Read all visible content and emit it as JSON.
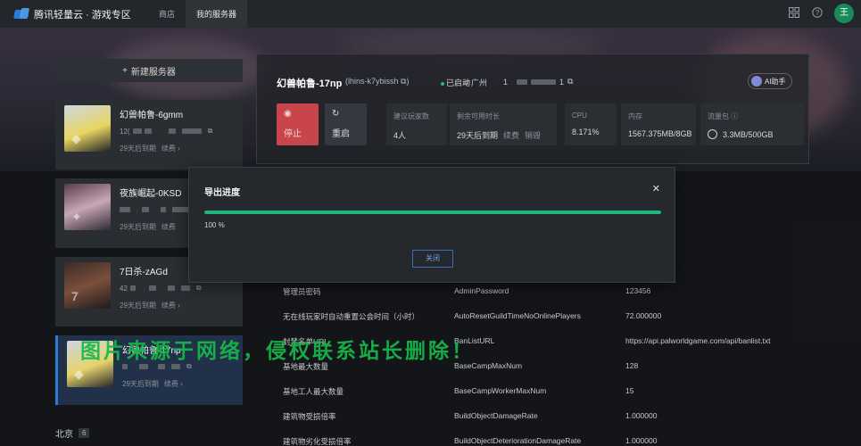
{
  "topbar": {
    "brand": "腾讯轻量云 · 游戏专区",
    "tabs": [
      {
        "label": "商店",
        "active": false
      },
      {
        "label": "我的服务器",
        "active": true
      }
    ],
    "avatar_label": "王",
    "icons": [
      "grid-icon",
      "help-icon"
    ]
  },
  "sidebar": {
    "new_server_label": "新建服务器",
    "servers": [
      {
        "name": "幻兽帕鲁-6gmm",
        "ip": "12(",
        "expiry": "29天后到期",
        "renew": "续费"
      },
      {
        "name": "夜族崛起-0KSD",
        "ip": "",
        "expiry": "29天后到期",
        "renew": "续费"
      },
      {
        "name": "7日杀-zAGd",
        "ip": "42",
        "expiry": "29天后到期",
        "renew": "续费"
      },
      {
        "name": "幻兽帕鲁-17np",
        "ip": "",
        "expiry": "29天后到期",
        "renew": "续费"
      }
    ],
    "region": {
      "label": "北京",
      "count": "6"
    }
  },
  "main": {
    "title": "幻兽帕鲁-17np",
    "instance_id": "(lhins-k7ybissh",
    "status": "已启动",
    "location": "广州",
    "ip_prefix": "1",
    "ip_suffix": "1",
    "ai_label": "AI助手",
    "stop_label": "停止",
    "restart_label": "重启",
    "stats": {
      "players_label": "建议玩家数",
      "players_value": "4人",
      "remaining_label": "剩余可用时长",
      "remaining_value": "29天后到期",
      "renew_label": "续费",
      "destroy_label": "销毁",
      "cpu_label": "CPU",
      "cpu_value": "8.171%",
      "mem_label": "内存",
      "mem_value": "1567.375MB/8GB",
      "traffic_label": "流量包",
      "traffic_value": "3.3MB/500GB"
    }
  },
  "config_rows": [
    {
      "name": "管理员密码",
      "key": "AdminPassword",
      "value": "123456"
    },
    {
      "name": "无在线玩家时自动重置公会时间（小时）",
      "key": "AutoResetGuildTimeNoOnlinePlayers",
      "value": "72.000000"
    },
    {
      "name": "封禁名单URL",
      "key": "BanListURL",
      "value": "https://api.palworldgame.com/api/banlist.txt"
    },
    {
      "name": "基地最大数量",
      "key": "BaseCampMaxNum",
      "value": "128"
    },
    {
      "name": "基地工人最大数量",
      "key": "BaseCampWorkerMaxNum",
      "value": "15"
    },
    {
      "name": "建筑物受损倍率",
      "key": "BuildObjectDamageRate",
      "value": "1.000000"
    },
    {
      "name": "建筑物劣化受损倍率",
      "key": "BuildObjectDeteriorationDamageRate",
      "value": "1.000000"
    }
  ],
  "watermark": "图片来源于网络，侵权联系站长删除！",
  "modal": {
    "title": "导出进度",
    "progress": 1.0,
    "progress_text": "100 %",
    "close_button": "关闭"
  }
}
